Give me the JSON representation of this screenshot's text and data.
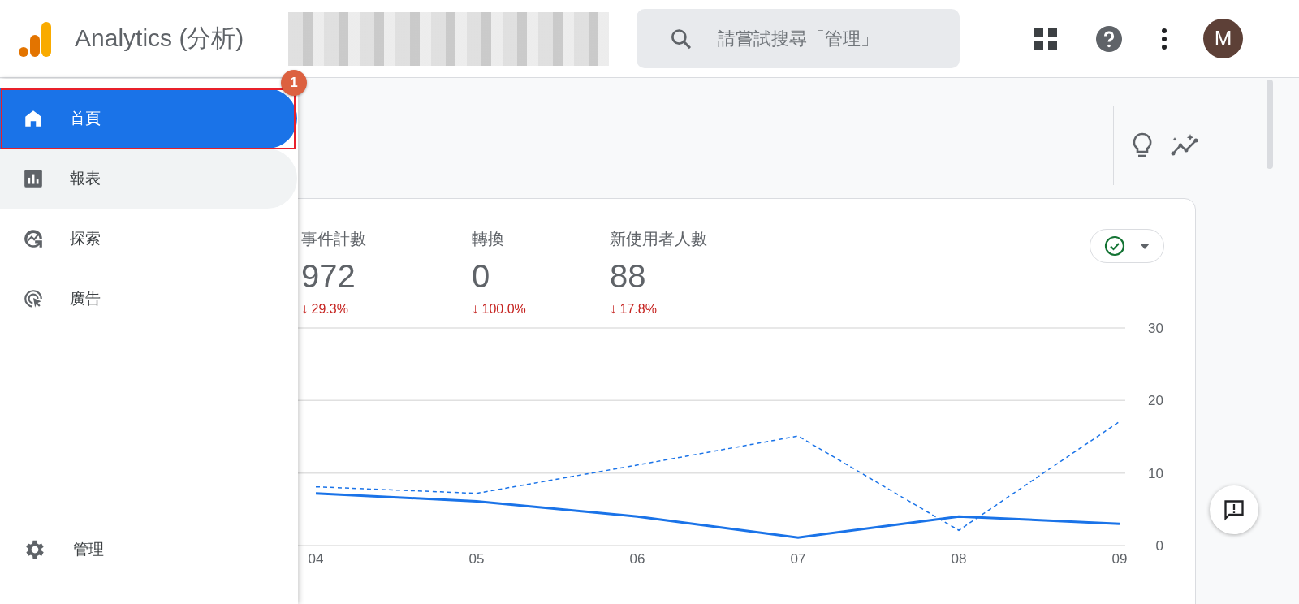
{
  "header": {
    "product": "Analytics (分析)",
    "search": {
      "placeholder": "請嘗試搜尋「管理」"
    },
    "avatar": "M"
  },
  "nav": {
    "items": [
      {
        "kind": "home",
        "label": "首頁",
        "selected": true,
        "highlighted": false
      },
      {
        "kind": "reports",
        "label": "報表",
        "selected": false,
        "highlighted": true
      },
      {
        "kind": "explore",
        "label": "探索",
        "selected": false,
        "highlighted": false
      },
      {
        "kind": "ads",
        "label": "廣告",
        "selected": false,
        "highlighted": false
      }
    ],
    "admin": {
      "label": "管理"
    },
    "annotation": {
      "badge": "1"
    }
  },
  "metrics": [
    {
      "label": "事件計數",
      "value": "972",
      "arrow": "↓",
      "change": "29.3%"
    },
    {
      "label": "轉換",
      "value": "0",
      "arrow": "↓",
      "change": "100.0%"
    },
    {
      "label": "新使用者人數",
      "value": "88",
      "arrow": "↓",
      "change": "17.8%"
    }
  ],
  "chart": {
    "chart_data": {
      "type": "line",
      "categories": [
        "04",
        "05",
        "06",
        "07",
        "08",
        "09"
      ],
      "ylim": [
        0,
        30
      ],
      "yticks": [
        0,
        10,
        20,
        30
      ],
      "series": [
        {
          "color": "#1a73e8",
          "line_style": "solid",
          "values": [
            7.2,
            6.1,
            4.0,
            1.1,
            4.0,
            3.0
          ]
        },
        {
          "color": "#1a73e8",
          "line_style": "dashed",
          "values": [
            8.1,
            7.2,
            11.1,
            15.1,
            2.1,
            17.1
          ]
        }
      ]
    }
  }
}
